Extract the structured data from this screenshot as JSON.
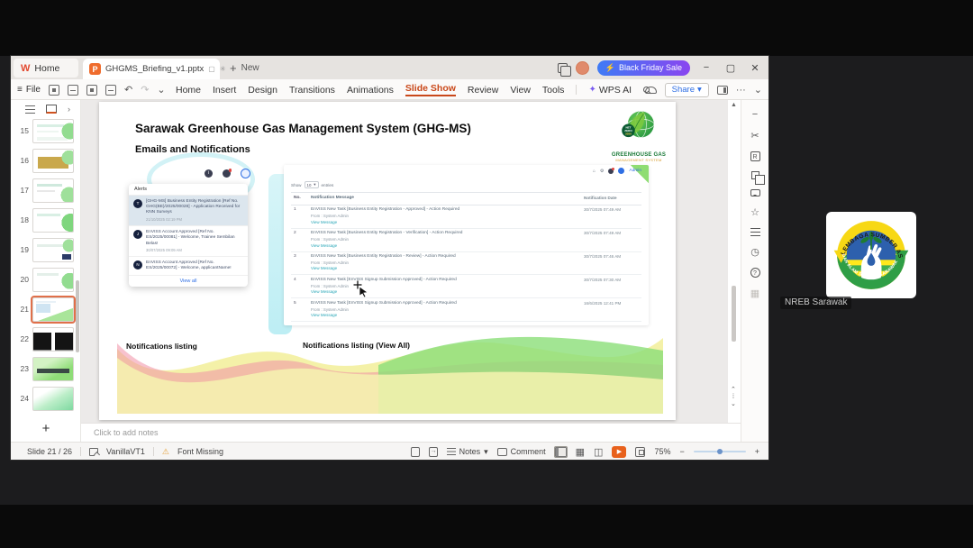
{
  "titlebar": {
    "home_tab": "Home",
    "doc_tab": "GHGMS_Briefing_v1.pptx",
    "new_label": "New",
    "sale_button": "Black Friday Sale"
  },
  "menubar": {
    "file": "File",
    "items": [
      "Home",
      "Insert",
      "Design",
      "Transitions",
      "Animations",
      "Slide Show",
      "Review",
      "View",
      "Tools"
    ],
    "wps_ai": "WPS AI",
    "share_button": "Share"
  },
  "icons": {
    "hamburger": "≡",
    "plus": "+",
    "lightning": "⚡",
    "minimize": "−",
    "maximize": "▢",
    "close": "✕",
    "asterisk": "✳",
    "sync_box": "▢",
    "undo": "↶",
    "redo": "↷",
    "chevron_down": "⌄",
    "chevron_right": "›",
    "dropdown": "▾",
    "ellipsis": "···",
    "sparkle": "✦",
    "warning": "⚠",
    "up_arrow": "▲",
    "up_chev": "⌃",
    "dots": "⁞",
    "down_chev": "⌄",
    "minus_tool": "−",
    "scissors": "✂",
    "star": "☆",
    "gear": "⚙",
    "clock": "◷",
    "question": "?",
    "grid": "▦",
    "book": "◫",
    "play": "▶",
    "home_mini": "⌂",
    "theme_letter": "R",
    "info_i": "i"
  },
  "slide_panel": {
    "slides": [
      {
        "num": "15"
      },
      {
        "num": "16"
      },
      {
        "num": "17"
      },
      {
        "num": "18"
      },
      {
        "num": "19"
      },
      {
        "num": "20"
      },
      {
        "num": "21"
      },
      {
        "num": "22"
      },
      {
        "num": "23"
      },
      {
        "num": "24"
      }
    ]
  },
  "slide": {
    "title": "Sarawak Greenhouse Gas Management System (GHG-MS)",
    "subtitle": "Emails and Notifications",
    "logo": {
      "badge_l1": "NET",
      "badge_l2": "ZERO",
      "badge_l3": "2050",
      "line1": "GREENHOUSE GAS",
      "line2": "MANAGEMENT SYSTEM"
    },
    "caption_left": "Notifications listing",
    "caption_right": "Notifications listing (View All)"
  },
  "alerts_panel": {
    "title": "Alerts",
    "items": [
      {
        "avatar": "T",
        "text": "[GHG-MS] Business Entity Registration [Ref No. GHG(BE)/2025/00028] - Application Received for KNN Surveys",
        "time": "21/10/2025 02:19 PM"
      },
      {
        "avatar": "J",
        "text": "EnVISS Account Approved [Ref No. ES/2025/00081] - Welcome, Trainee Sembilan Belas!",
        "time": "30/07/2025 09:09 AM"
      },
      {
        "avatar": "N",
        "text": "EnVISS Account Approved [Ref No. ES/2025/00072] - Welcome, applicantName!",
        "time": ""
      }
    ],
    "view_all": "View all"
  },
  "notif_table": {
    "user": "Admin",
    "show_label": "Show",
    "page_size": "10",
    "entries_label": "entries",
    "headers": {
      "no": "No.",
      "message": "Notification Message",
      "date": "Notification Date"
    },
    "from_line": "From : System Admin",
    "link_label": "View Message",
    "rows": [
      {
        "no": "1",
        "message": "EnVISS New Task [Business Entity Registration - Approved] - Action Required",
        "date": "30/7/2025 07:49 AM"
      },
      {
        "no": "2",
        "message": "EnVISS New Task [Business Entity Registration - Verification] - Action Required",
        "date": "30/7/2025 07:49 AM"
      },
      {
        "no": "3",
        "message": "EnVISS New Task [Business Entity Registration - Review] - Action Required",
        "date": "30/7/2025 07:46 AM"
      },
      {
        "no": "4",
        "message": "EnVISS New Task [EnVISS Signup Submission Approved] - Action Required",
        "date": "30/7/2025 07:30 AM"
      },
      {
        "no": "5",
        "message": "EnVISS New Task [EnVISS Signup Submission Approved] - Action Required",
        "date": "16/6/2025 12:41 PM"
      }
    ]
  },
  "notes": {
    "placeholder": "Click to add notes"
  },
  "statusbar": {
    "slide_indicator": "Slide 21 / 26",
    "theme_name": "VanillaVT1",
    "font_missing": "Font Missing",
    "notes_label": "Notes",
    "comment_label": "Comment",
    "zoom_level": "75%"
  },
  "meeting": {
    "participant_label": "NREB Sarawak"
  },
  "colors": {
    "accent_orange": "#c9481a",
    "sale_from": "#3f7bf5",
    "sale_to": "#8a45f0",
    "link_blue": "#2f6fe4",
    "link_teal": "#2aa7b8",
    "play_orange": "#e8611c"
  }
}
